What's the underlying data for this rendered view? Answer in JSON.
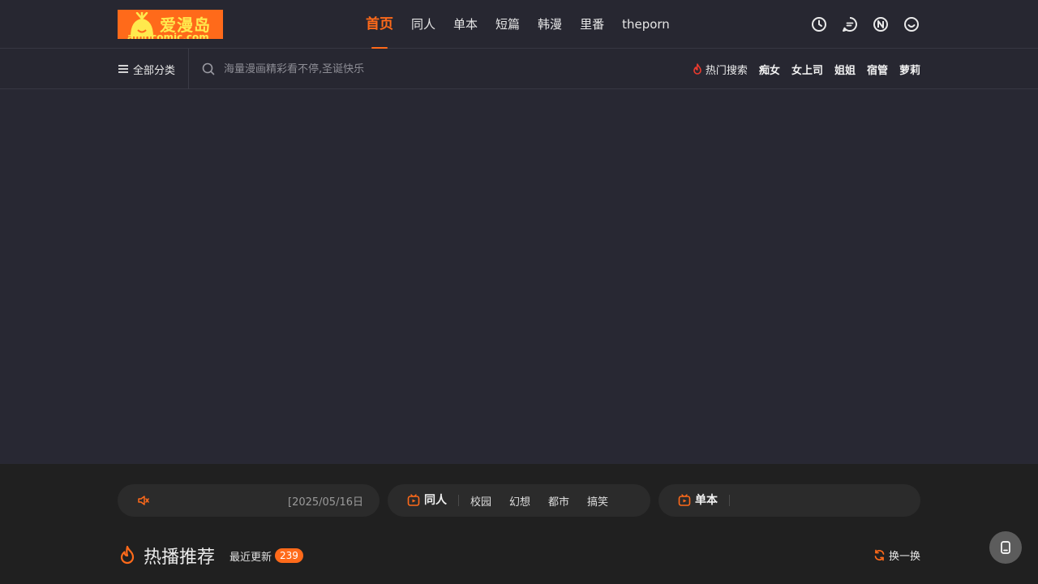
{
  "header": {
    "logo": {
      "title": "爱漫岛",
      "subtitle": "amdcomic.com"
    },
    "nav": [
      {
        "label": "首页",
        "active": true
      },
      {
        "label": "同人",
        "active": false
      },
      {
        "label": "单本",
        "active": false
      },
      {
        "label": "短篇",
        "active": false
      },
      {
        "label": "韩漫",
        "active": false
      },
      {
        "label": "里番",
        "active": false
      },
      {
        "label": "theporn",
        "active": false
      }
    ],
    "tools": [
      "clock-icon",
      "message-icon",
      "n-badge-icon",
      "smile-icon"
    ]
  },
  "subbar": {
    "category_label": "全部分类",
    "search_placeholder": "海量漫画精彩看不停,圣诞快乐",
    "hot_title": "热门搜索",
    "hot_tags": [
      "痴女",
      "女上司",
      "姐姐",
      "宿管",
      "萝莉"
    ]
  },
  "notice": {
    "text": "[2025/05/16日 ユ"
  },
  "categories": [
    {
      "title": "同人",
      "links": [
        "校园",
        "幻想",
        "都市",
        "搞笑"
      ]
    },
    {
      "title": "单本",
      "links": []
    }
  ],
  "section": {
    "title": "热播推荐",
    "recent_label": "最近更新",
    "recent_count": "239",
    "refresh_label": "换一换"
  },
  "colors": {
    "accent": "#ff6a1a",
    "header_bg": "#272731",
    "page_bg": "#202020"
  }
}
